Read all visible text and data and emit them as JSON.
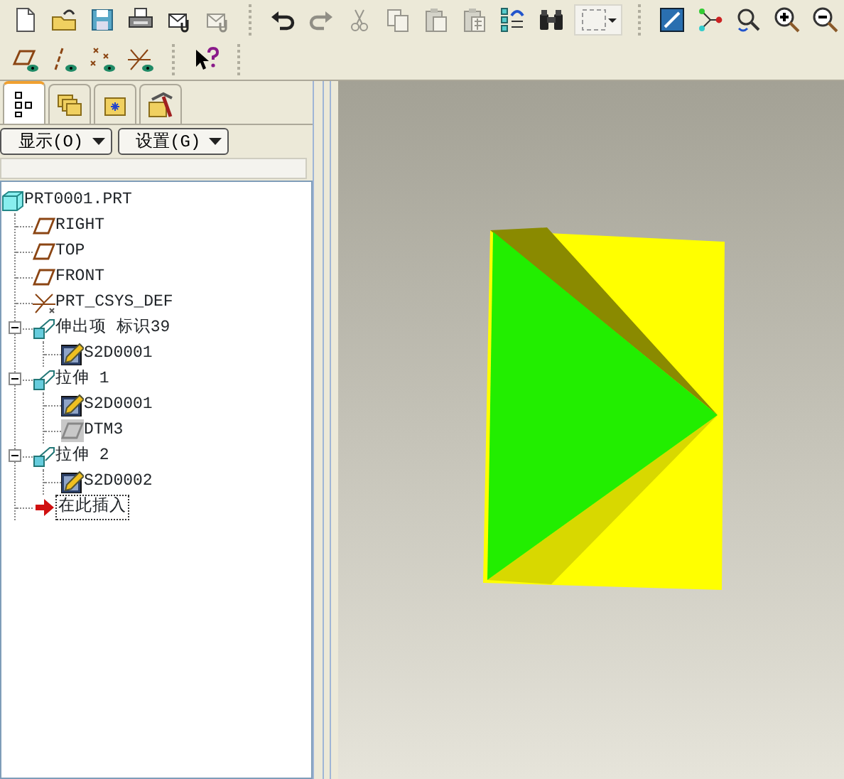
{
  "toolbar": {
    "rows": [
      {
        "groups": [
          [
            {
              "kind": "new",
              "disabled": false
            },
            {
              "kind": "open",
              "disabled": false
            },
            {
              "kind": "save",
              "disabled": false
            },
            {
              "kind": "print",
              "disabled": false
            },
            {
              "kind": "mail",
              "disabled": false
            },
            {
              "kind": "mail",
              "disabled": true
            }
          ],
          [
            {
              "kind": "undo",
              "disabled": false
            },
            {
              "kind": "redo",
              "disabled": true
            },
            {
              "kind": "cut",
              "disabled": true
            },
            {
              "kind": "copy",
              "disabled": true
            },
            {
              "kind": "paste",
              "disabled": true
            },
            {
              "kind": "paste-special",
              "disabled": true
            },
            {
              "kind": "regenerate",
              "disabled": false
            },
            {
              "kind": "find",
              "disabled": false
            },
            {
              "kind": "select-box",
              "disabled": false
            }
          ],
          [
            {
              "kind": "repaint",
              "disabled": false
            },
            {
              "kind": "spin-center",
              "disabled": false
            },
            {
              "kind": "orient",
              "disabled": false
            },
            {
              "kind": "zoom-in",
              "disabled": false
            },
            {
              "kind": "zoom-out",
              "disabled": false
            }
          ]
        ]
      },
      {
        "groups": [
          [
            {
              "kind": "plane-display",
              "disabled": false
            },
            {
              "kind": "axis-display",
              "disabled": false
            },
            {
              "kind": "point-display",
              "disabled": false
            },
            {
              "kind": "csys-display",
              "disabled": false
            }
          ],
          [
            {
              "kind": "help",
              "disabled": false
            }
          ]
        ]
      }
    ]
  },
  "navigator": {
    "tabs": [
      {
        "kind": "model-tree",
        "selected": true
      },
      {
        "kind": "folders",
        "selected": false
      },
      {
        "kind": "favorites",
        "selected": false
      },
      {
        "kind": "connections",
        "selected": false
      }
    ],
    "buttons": [
      {
        "label": "显示(O)"
      },
      {
        "label": "设置(G)"
      }
    ],
    "tree": {
      "label": "PRT0001.PRT",
      "kind": "part",
      "children": [
        {
          "label": "RIGHT",
          "kind": "plane"
        },
        {
          "label": "TOP",
          "kind": "plane"
        },
        {
          "label": "FRONT",
          "kind": "plane"
        },
        {
          "label": "PRT_CSYS_DEF",
          "kind": "csys"
        },
        {
          "label": "伸出项 标识39",
          "kind": "feature",
          "expanded": true,
          "children": [
            {
              "label": "S2D0001",
              "kind": "sketch"
            }
          ]
        },
        {
          "label": "拉伸 1",
          "kind": "feature",
          "expanded": true,
          "children": [
            {
              "label": "S2D0001",
              "kind": "sketch"
            },
            {
              "label": "DTM3",
              "kind": "hidden-plane"
            }
          ]
        },
        {
          "label": "拉伸 2",
          "kind": "feature",
          "expanded": true,
          "children": [
            {
              "label": "S2D0002",
              "kind": "sketch"
            }
          ]
        },
        {
          "label": "在此插入",
          "kind": "insert"
        }
      ]
    }
  }
}
